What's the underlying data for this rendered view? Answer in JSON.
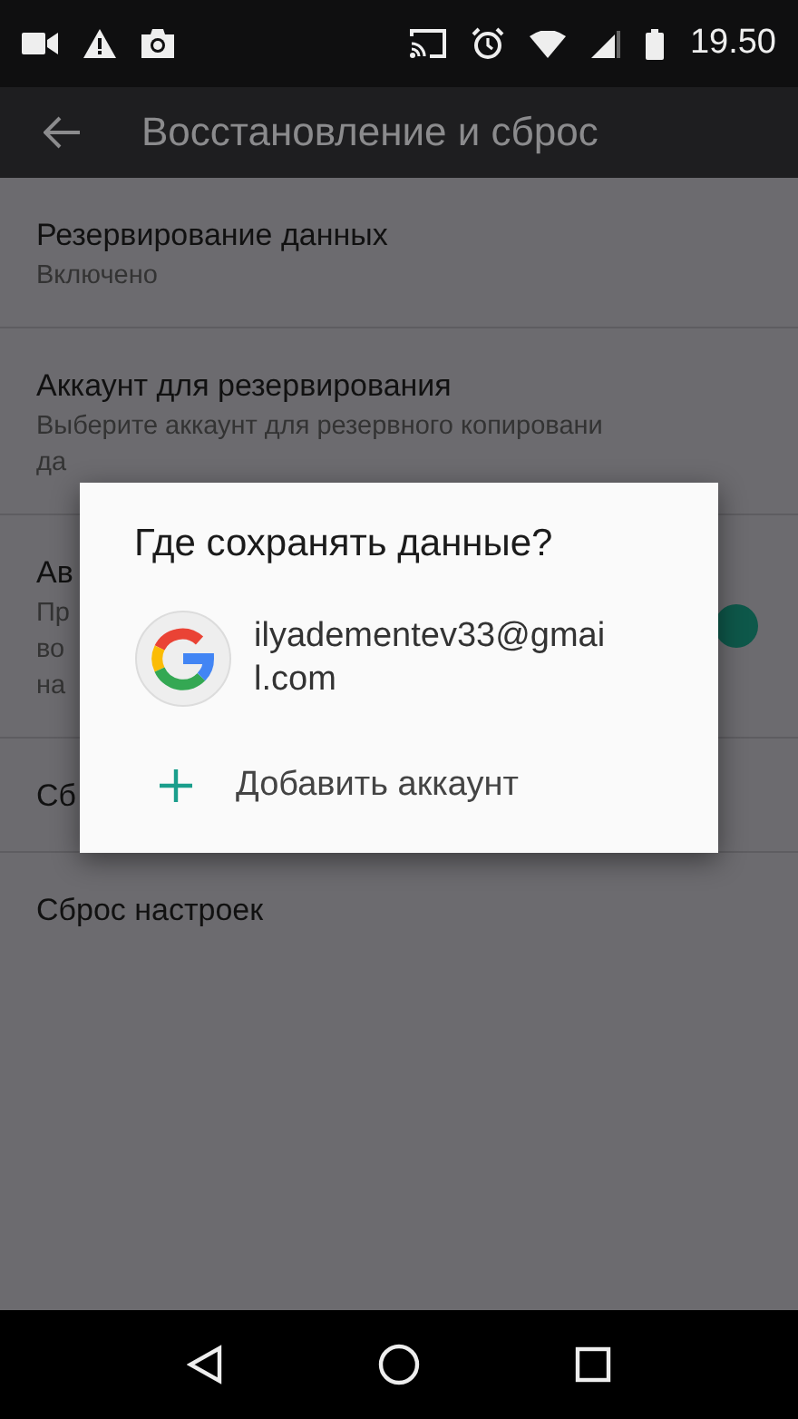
{
  "status_bar": {
    "time": "19.50"
  },
  "app_bar": {
    "title": "Восстановление и сброс"
  },
  "settings": [
    {
      "title": "Резервирование данных",
      "lines": [
        "Включено"
      ]
    },
    {
      "title": "Аккаунт для резервирования",
      "lines": [
        "Выберите аккаунт для резервного копировани",
        "да"
      ]
    },
    {
      "title": "Ав",
      "lines": [
        "Пр",
        "во",
        "на"
      ],
      "toggle": {
        "on": true
      }
    },
    {
      "title": "Сб"
    },
    {
      "title": "Сброс настроек"
    }
  ],
  "dialog": {
    "title": "Где сохранять данные?",
    "accounts": [
      {
        "email": "ilyadementev33@gmail.com"
      }
    ],
    "add_label": "Добавить аккаунт"
  }
}
